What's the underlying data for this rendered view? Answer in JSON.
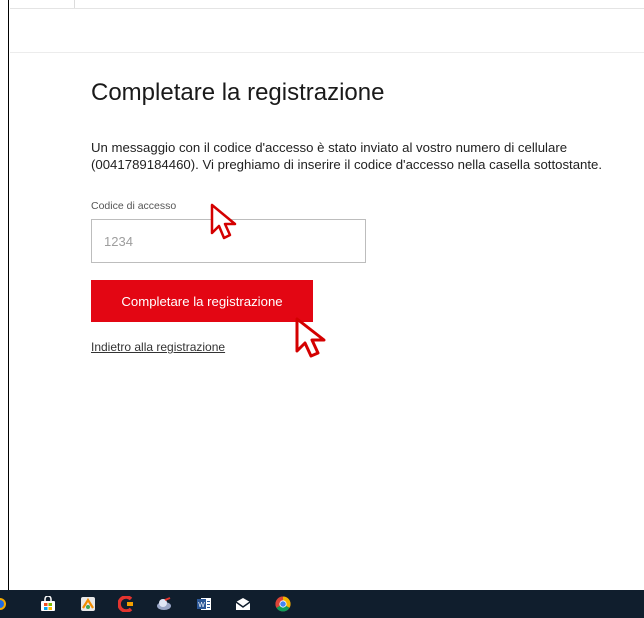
{
  "page": {
    "title": "Completare la registrazione",
    "message_line1": "Un messaggio con il codice d'accesso è stato inviato al vostro numero di cellulare",
    "message_line2": "(0041789184460). Vi preghiamo di inserire il codice d'accesso nella casella sottostante."
  },
  "form": {
    "code_label": "Codice di accesso",
    "code_placeholder": "1234",
    "code_value": "",
    "submit_label": "Completare la registrazione",
    "back_link": "Indietro alla registrazione"
  },
  "colors": {
    "accent": "#e30613",
    "taskbar": "#101e2d"
  },
  "taskbar": {
    "icons": [
      "partial-circle-icon",
      "store-icon",
      "app-icon",
      "ccleaner-icon",
      "satellite-app-icon",
      "word-icon",
      "mail-icon",
      "chrome-icon"
    ]
  }
}
